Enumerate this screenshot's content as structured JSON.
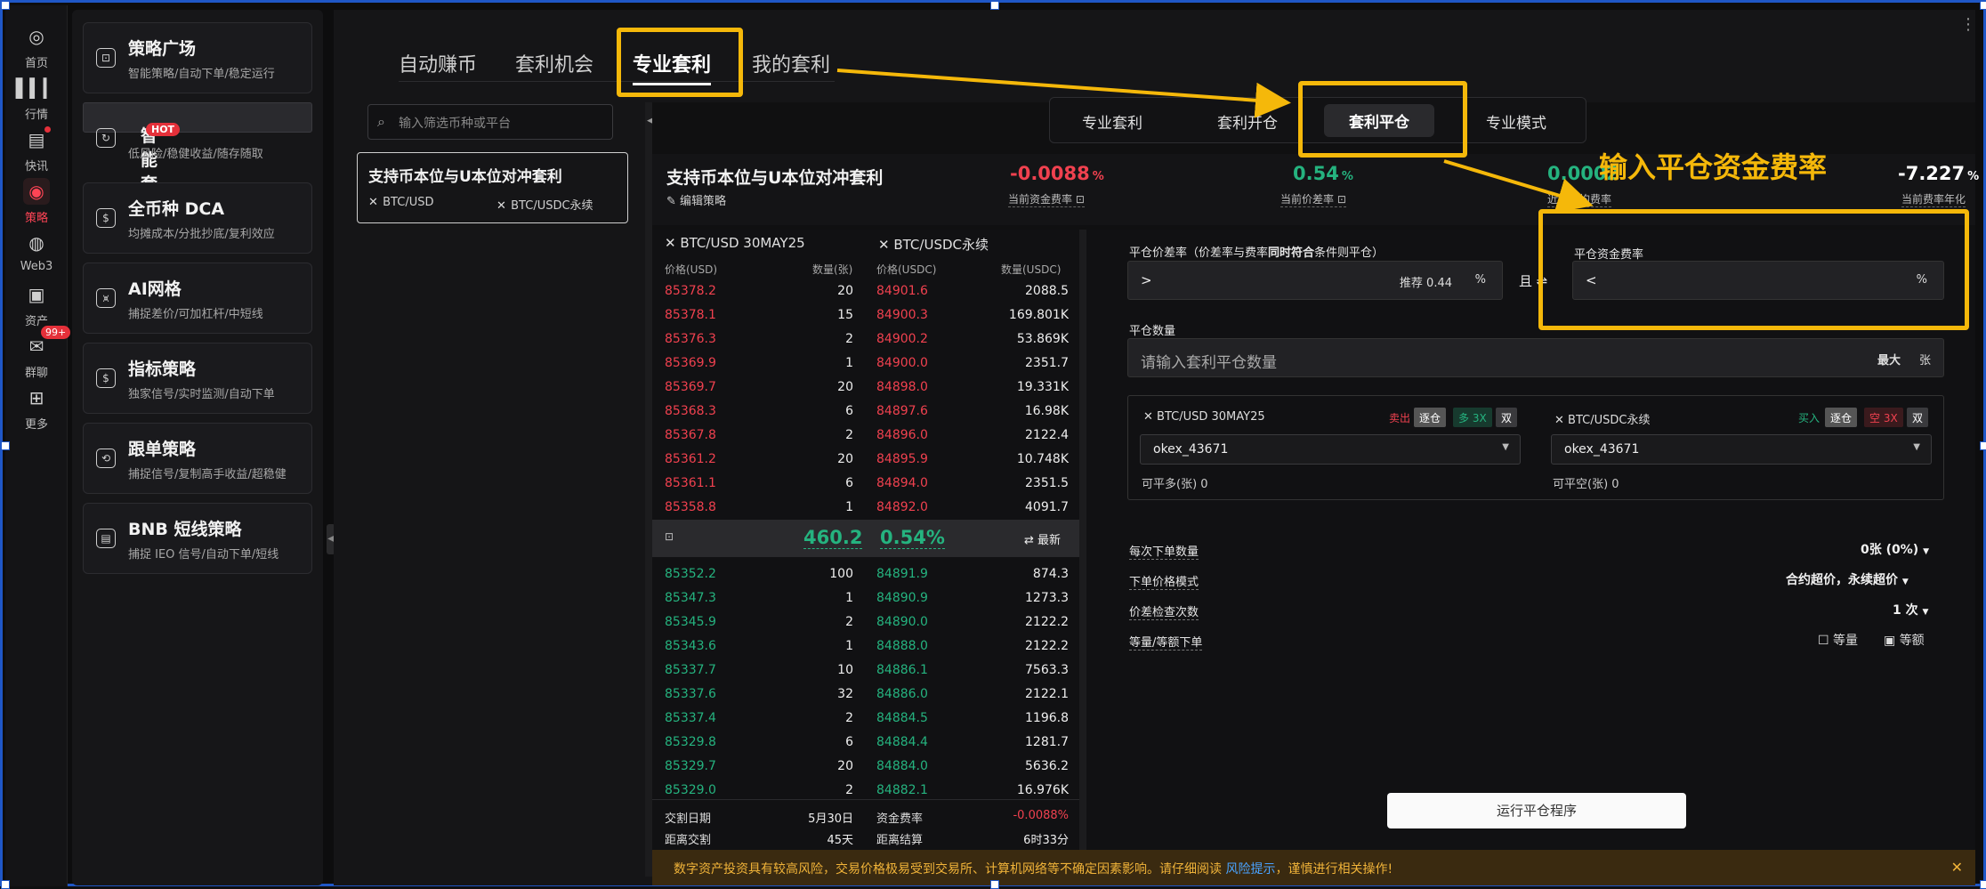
{
  "rail": [
    {
      "label": "首页",
      "icon": "home-icon"
    },
    {
      "label": "行情",
      "icon": "chart-bars-icon"
    },
    {
      "label": "快讯",
      "icon": "news-icon"
    },
    {
      "label": "策略",
      "icon": "robot-icon"
    },
    {
      "label": "Web3",
      "icon": "web3-icon"
    },
    {
      "label": "资产",
      "icon": "wallet-icon"
    },
    {
      "label": "群聊",
      "icon": "chat-icon",
      "badge": "99+"
    },
    {
      "label": "更多",
      "icon": "grid-more-icon"
    }
  ],
  "strategies": [
    {
      "title": "策略广场",
      "sub": "智能策略/自动下单/稳定运行",
      "icon": "robot-icon"
    },
    {
      "title": "智能套利",
      "sub": "低风险/稳健收益/随存随取",
      "icon": "refresh-icon",
      "badge": "HOT"
    },
    {
      "title": "全币种 DCA",
      "sub": "均摊成本/分批抄底/复利效应",
      "icon": "dca-icon"
    },
    {
      "title": "AI网格",
      "sub": "捕捉差价/可加杠杆/中短线",
      "icon": "grid-icon"
    },
    {
      "title": "指标策略",
      "sub": "独家信号/实时监测/自动下单",
      "icon": "signal-icon"
    },
    {
      "title": "跟单策略",
      "sub": "捕捉信号/复制高手收益/超稳健",
      "icon": "copy-icon"
    },
    {
      "title": "BNB 短线策略",
      "sub": "捕捉 IEO 信号/自动下单/短线",
      "icon": "bnb-icon"
    }
  ],
  "tabs": [
    "自动赚币",
    "套利机会",
    "专业套利",
    "我的套利"
  ],
  "search_placeholder": "输入筛选币种或平台",
  "pair": {
    "title": "支持币本位与U本位对冲套利",
    "a": "BTC/USD",
    "b": "BTC/USDC永续"
  },
  "modes": [
    "专业套利",
    "套利开仓",
    "套利平仓",
    "专业模式"
  ],
  "annotation": "输入平仓资金费率",
  "stats": {
    "title": "支持币本位与U本位对冲套利",
    "edit": "编辑策略",
    "items": [
      {
        "value": "-0.0088",
        "pct": "%",
        "label": "当前资金费率",
        "color": "red"
      },
      {
        "value": "0.54",
        "pct": "%",
        "label": "当前价差率",
        "color": "green"
      },
      {
        "value": "0.0002",
        "pct": "",
        "label": "近期平均费率",
        "color": "green"
      },
      {
        "value": "-7.227",
        "pct": "%",
        "label": "当前费率年化",
        "color": "white"
      }
    ]
  },
  "orderbook": {
    "left_title": "BTC/USD 30MAY25",
    "right_title": "BTC/USDC永续",
    "cols": [
      "价格(USD)",
      "数量(张)",
      "价格(USDC)",
      "数量(USDC)"
    ],
    "asks": [
      [
        "85378.2",
        "20",
        "84901.6",
        "2088.5"
      ],
      [
        "85378.1",
        "15",
        "84900.3",
        "169.801K"
      ],
      [
        "85376.3",
        "2",
        "84900.2",
        "53.869K"
      ],
      [
        "85369.9",
        "1",
        "84900.0",
        "2351.7"
      ],
      [
        "85369.7",
        "20",
        "84898.0",
        "19.331K"
      ],
      [
        "85368.3",
        "6",
        "84897.6",
        "16.98K"
      ],
      [
        "85367.8",
        "2",
        "84896.0",
        "2122.4"
      ],
      [
        "85361.2",
        "20",
        "84895.9",
        "10.748K"
      ],
      [
        "85361.1",
        "6",
        "84894.0",
        "2351.5"
      ],
      [
        "85358.8",
        "1",
        "84892.0",
        "4091.7"
      ]
    ],
    "mid": {
      "spread": "460.2",
      "rate": "0.54%",
      "latest": "最新"
    },
    "bids": [
      [
        "85352.2",
        "100",
        "84891.9",
        "874.3"
      ],
      [
        "85347.3",
        "1",
        "84890.9",
        "1273.3"
      ],
      [
        "85345.9",
        "2",
        "84890.0",
        "2122.2"
      ],
      [
        "85343.6",
        "1",
        "84888.0",
        "2122.2"
      ],
      [
        "85337.7",
        "10",
        "84886.1",
        "7563.3"
      ],
      [
        "85337.6",
        "32",
        "84886.0",
        "2122.1"
      ],
      [
        "85337.4",
        "2",
        "84884.5",
        "1196.8"
      ],
      [
        "85329.8",
        "6",
        "84884.4",
        "1281.7"
      ],
      [
        "85329.7",
        "20",
        "84884.0",
        "5636.2"
      ],
      [
        "85329.0",
        "2",
        "84882.1",
        "16.976K"
      ]
    ],
    "footer": [
      {
        "k": "交割日期",
        "v": "5月30日",
        "k2": "资金费率",
        "v2": "-0.0088%"
      },
      {
        "k": "距离交割",
        "v": "45天",
        "k2": "距离结算",
        "v2": "6时33分"
      }
    ]
  },
  "form": {
    "spread_label_a": "平仓价差率（价差率与费率",
    "spread_label_b": "同时符合",
    "spread_label_c": "条件则平仓）",
    "spread_symbol": ">",
    "recommend": "推荐 0.44",
    "unit_pct": "%",
    "and": "且",
    "fund_label": "平仓资金费率",
    "fund_symbol": "<",
    "qty_label": "平仓数量",
    "qty_placeholder": "请输入套利平仓数量",
    "qty_max": "最大",
    "qty_unit": "张",
    "acc_left": {
      "pair": "BTC/USD 30MAY25",
      "side": "卖出",
      "mode": "逐仓",
      "lev": "多 3X",
      "dual": "双",
      "account": "okex_43671",
      "avail": "可平多(张) 0"
    },
    "acc_right": {
      "pair": "BTC/USDC永续",
      "side": "买入",
      "mode": "逐仓",
      "lev": "空 3X",
      "dual": "双",
      "account": "okex_43671",
      "avail": "可平空(张) 0"
    },
    "opts": [
      {
        "k": "每次下单数量",
        "v": "0张 (0%)"
      },
      {
        "k": "下单价格模式",
        "v": "合约超价，永续超价"
      },
      {
        "k": "价差检查次数",
        "v": "1 次"
      },
      {
        "k": "等量/等额下单",
        "v": ""
      }
    ],
    "equal_qty": "等量",
    "equal_amt": "等额",
    "run": "运行平仓程序"
  },
  "footer_notice_a": "数字资产投资具有较高风险，交易价格极易受到交易所、计算机网络等不确定因素影响。请仔细阅读",
  "footer_link": "风险提示",
  "footer_notice_b": "，谨慎进行相关操作!",
  "footer_close": "✕"
}
